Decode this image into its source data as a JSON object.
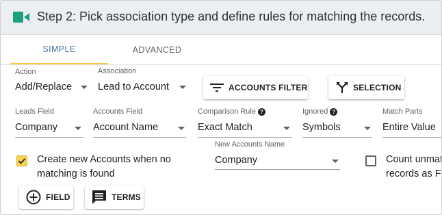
{
  "header": {
    "title": "Step 2: Pick association type and define rules for matching the records.",
    "icon": "video-camera-icon",
    "accent_color": "#1aa07e"
  },
  "tabs": [
    {
      "label": "SIMPLE",
      "active": true
    },
    {
      "label": "ADVANCED",
      "active": false
    }
  ],
  "row1": {
    "action": {
      "label": "Action",
      "value": "Add/Replace"
    },
    "association": {
      "label": "Association",
      "value": "Lead to Account"
    },
    "accounts_filter_button": {
      "label": "ACCOUNTS FILTER",
      "icon": "filter-icon"
    },
    "selection_button": {
      "label": "SELECTION",
      "icon": "merge-icon"
    }
  },
  "row2": {
    "leads_field": {
      "label": "Leads Field",
      "value": "Company"
    },
    "accounts_field": {
      "label": "Accounts Field",
      "value": "Account Name"
    },
    "comparison_rule": {
      "label": "Comparison Rule",
      "value": "Exact Match",
      "help_icon": "help-icon"
    },
    "ignored": {
      "label": "Ignored",
      "value": "Symbols",
      "help_icon": "help-icon"
    },
    "match_parts": {
      "label": "Match Parts",
      "value": "Entire Value"
    }
  },
  "row3": {
    "create_accounts": {
      "checked": true,
      "line1": "Create new Accounts when no",
      "line2": "matching is found",
      "check_color": "#f7d154"
    },
    "new_accounts_name": {
      "label": "New Accounts Name",
      "value": "Company"
    },
    "count_unmatched": {
      "checked": false,
      "line1": "Count unmat",
      "line2": "records as Fa"
    }
  },
  "bottom_buttons": {
    "field": {
      "label": "FIELD",
      "icon": "add-circle-icon"
    },
    "terms": {
      "label": "TERMS",
      "icon": "comment-icon"
    }
  }
}
